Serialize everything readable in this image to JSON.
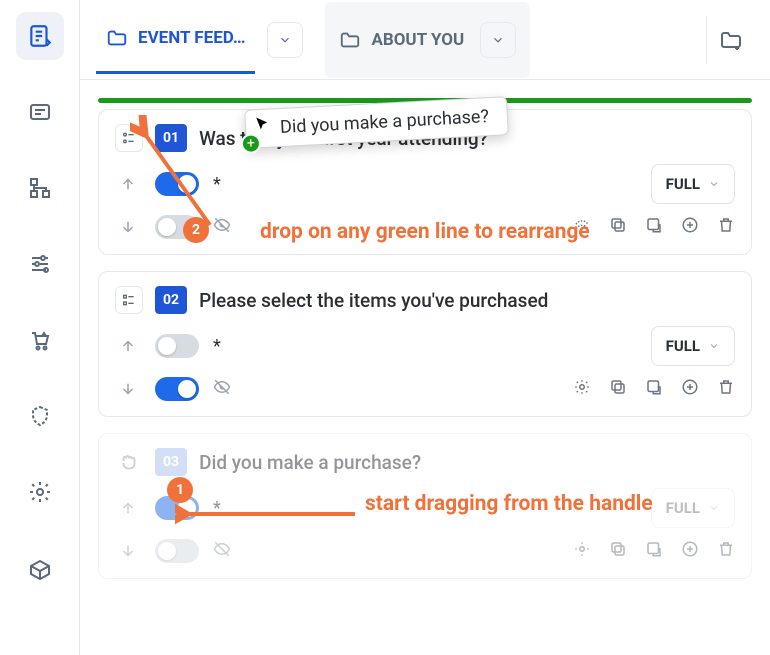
{
  "colors": {
    "accent": "#1e56d6",
    "drop": "#1a9a1a",
    "annot": "#f0723a"
  },
  "tabs": {
    "active": {
      "label": "EVENT FEED…"
    },
    "inactive": {
      "label": "ABOUT YOU"
    }
  },
  "cards": [
    {
      "num": "01",
      "title": "Was this your first year attending?",
      "toggle1": "on",
      "toggle2": "off",
      "full": "FULL"
    },
    {
      "num": "02",
      "title": "Please select the items you've purchased",
      "toggle1": "off",
      "toggle2": "on",
      "full": "FULL"
    },
    {
      "num": "03",
      "title": "Did you make a purchase?",
      "toggle1": "on",
      "toggle2": "off",
      "full": "FULL"
    }
  ],
  "drag_ghost": {
    "text": "Did you make a purchase?"
  },
  "annotations": {
    "step1": {
      "num": "1",
      "text": "start dragging from the handle"
    },
    "step2": {
      "num": "2",
      "text": "drop on any green line to rearrange"
    }
  },
  "misc": {
    "star": "*"
  }
}
